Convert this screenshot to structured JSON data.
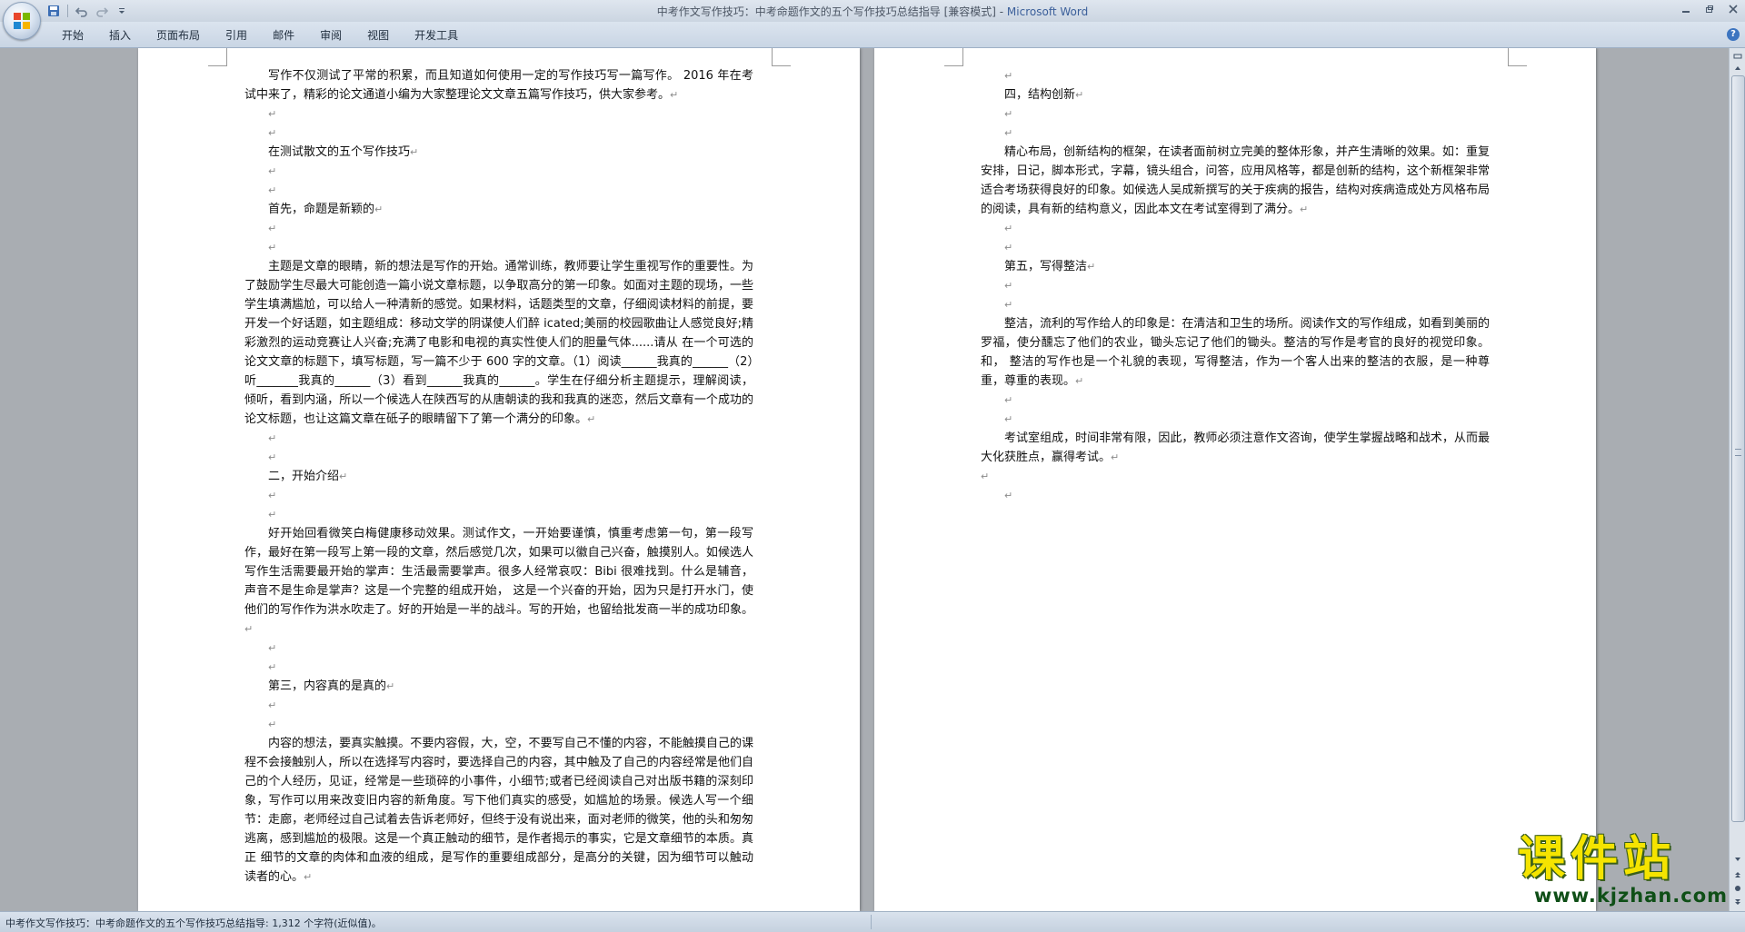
{
  "window": {
    "title_doc": "中考作文写作技巧：中考命题作文的五个写作技巧总结指导 [兼容模式] - ",
    "title_app": "Microsoft Word"
  },
  "ribbon": {
    "tabs": [
      "开始",
      "插入",
      "页面布局",
      "引用",
      "邮件",
      "审阅",
      "视图",
      "开发工具"
    ]
  },
  "icons": {
    "office_button": "office-logo-icon",
    "save": "save-icon",
    "undo": "undo-icon",
    "redo": "redo-icon",
    "customize": "customize-qat-icon",
    "help": "help-icon"
  },
  "mark": "↵",
  "help_label": "?",
  "document": {
    "left_page": [
      {
        "type": "p",
        "indent": true,
        "text": "写作不仅测试了平常的积累，而且知道如何使用一定的写作技巧写一篇写作。 2016 年在考试中来了，精彩的论文通道小编为大家整理论文文章五篇写作技巧，供大家参考。"
      },
      {
        "type": "empty"
      },
      {
        "type": "empty"
      },
      {
        "type": "p",
        "indent": true,
        "text": "在测试散文的五个写作技巧"
      },
      {
        "type": "empty"
      },
      {
        "type": "empty"
      },
      {
        "type": "p",
        "indent": true,
        "text": "首先，命题是新颖的"
      },
      {
        "type": "empty"
      },
      {
        "type": "empty"
      },
      {
        "type": "p",
        "indent": true,
        "text": "主题是文章的眼睛，新的想法是写作的开始。通常训练，教师要让学生重视写作的重要性。为了鼓励学生尽最大可能创造一篇小说文章标题，以争取高分的第一印象。如面对主题的现场，一些学生填满尴尬，可以给人一种清新的感觉。如果材料，话题类型的文章，仔细阅读材料的前提，要开发一个好话题，如主题组成：移动文学的阴谋使人们醉 icated;美丽的校园歌曲让人感觉良好;精彩激烈的运动竞赛让人兴奋;充满了电影和电视的真实性使人们的胆量气体......请从 在一个可选的论文文章的标题下，填写标题，写一篇不少于 600 字的文章。（1）阅读______我真的______（2）听_______我真的______（3）看到______我真的______。学生在仔细分析主题提示，理解阅读，倾听，看到内涵，所以一个候选人在陕西写的从唐朝读的我和我真的迷恋，然后文章有一个成功的论文标题，也让这篇文章在砥子的眼睛留下了第一个满分的印象。"
      },
      {
        "type": "empty"
      },
      {
        "type": "empty"
      },
      {
        "type": "p",
        "indent": true,
        "text": "二，开始介绍"
      },
      {
        "type": "empty"
      },
      {
        "type": "empty"
      },
      {
        "type": "p",
        "indent": true,
        "text": "好开始回看微笑白梅健康移动效果。测试作文，一开始要谨慎，慎重考虑第一句，第一段写作，最好在第一段写上第一段的文章，然后感觉几次，如果可以徽自己兴奋，触摸别人。如候选人写作生活需要最开始的掌声：生活最需要掌声。很多人经常哀叹：Bibi 很难找到。什么是辅音，声音不是生命是掌声？这是一个完整的组成开始， 这是一个兴奋的开始，因为只是打开水门，使他们的写作作为洪水吹走了。好的开始是一半的战斗。写的开始，也留给批发商一半的成功印象。"
      },
      {
        "type": "empty"
      },
      {
        "type": "empty"
      },
      {
        "type": "p",
        "indent": true,
        "text": "第三，内容真的是真的"
      },
      {
        "type": "empty"
      },
      {
        "type": "empty"
      },
      {
        "type": "p",
        "indent": true,
        "text": "内容的想法，要真实触摸。不要内容假，大，空，不要写自己不懂的内容，不能触摸自己的课程不会接触别人，所以在选择写内容时，要选择自己的内容，其中触及了自己的内容经常是他们自己的个人经历，见证，经常是一些琐碎的小事件，小细节;或者已经阅读自己对出版书籍的深刻印象，写作可以用来改变旧内容的新角度。写下他们真实的感受，如尴尬的场景。候选人写一个细节：走廊，老师经过自己试着去告诉老师好，但终于没有说出来，面对老师的微笑，他的头和匆匆逃离，感到尴尬的极限。这是一个真正触动的细节，是作者揭示的事实，它是文章细节的本质。真正 细节的文章的肉体和血液的组成，是写作的重要组成部分，是高分的关键，因为细节可以触动读者的心。"
      }
    ],
    "right_page": [
      {
        "type": "empty"
      },
      {
        "type": "p",
        "indent": true,
        "text": "四，结构创新"
      },
      {
        "type": "empty"
      },
      {
        "type": "empty"
      },
      {
        "type": "p",
        "indent": true,
        "text": "精心布局，创新结构的框架，在读者面前树立完美的整体形象，并产生清晰的效果。如：重复安排，日记，脚本形式，字幕，镜头组合，问答，应用风格等，都是创新的结构，这个新框架非常适合考场获得良好的印象。如候选人吴成新撰写的关于疾病的报告，结构对疾病造成处方风格布局的阅读，具有新的结构意义，因此本文在考试室得到了满分。"
      },
      {
        "type": "empty"
      },
      {
        "type": "empty"
      },
      {
        "type": "p",
        "indent": true,
        "text": "第五，写得整洁"
      },
      {
        "type": "empty"
      },
      {
        "type": "empty"
      },
      {
        "type": "p",
        "indent": true,
        "text": "整洁，流利的写作给人的印象是：在清洁和卫生的场所。阅读作文的写作组成，如看到美丽的罗福，使分醺忘了他们的农业，锄头忘记了他们的锄头。整洁的写作是考官的良好的视觉印象。和， 整洁的写作也是一个礼貌的表现，写得整洁，作为一个客人出来的整洁的衣服，是一种尊重，尊重的表现。"
      },
      {
        "type": "empty"
      },
      {
        "type": "empty"
      },
      {
        "type": "p",
        "indent": true,
        "text": "考试室组成，时间非常有限，因此，教师必须注意作文咨询，使学生掌握战略和战术，从而最大化获胜点，赢得考试。"
      },
      {
        "type": "p",
        "indent": false,
        "text": ""
      },
      {
        "type": "empty"
      }
    ]
  },
  "statusbar": {
    "text": "中考作文写作技巧：中考命题作文的五个写作技巧总结指导: 1,312 个字符(近似值)。"
  },
  "watermark": {
    "cn": "课件站",
    "url": "www.kjzhan.com"
  }
}
